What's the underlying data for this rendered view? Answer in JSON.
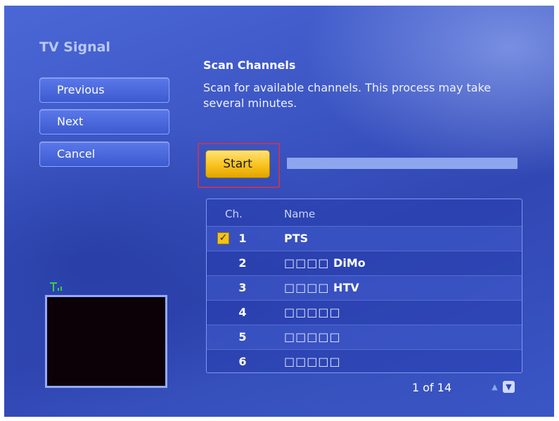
{
  "sidebar": {
    "title": "TV Signal",
    "buttons": [
      {
        "label": "Previous"
      },
      {
        "label": "Next"
      },
      {
        "label": "Cancel"
      }
    ]
  },
  "main": {
    "heading": "Scan Channels",
    "description": "Scan for available channels. This process may take several minutes.",
    "start_label": "Start",
    "progress": 0
  },
  "channel_list": {
    "headers": {
      "ch": "Ch.",
      "name": "Name"
    },
    "rows": [
      {
        "ch": "1",
        "prefix": "",
        "name": "PTS",
        "checked": true
      },
      {
        "ch": "2",
        "prefix": "□□□□",
        "name": "DiMo",
        "checked": false
      },
      {
        "ch": "3",
        "prefix": "□□□□",
        "name": "HTV",
        "checked": false
      },
      {
        "ch": "4",
        "prefix": "□□□□□",
        "name": "",
        "checked": false
      },
      {
        "ch": "5",
        "prefix": "□□□□□",
        "name": "",
        "checked": false
      },
      {
        "ch": "6",
        "prefix": "□□□□□",
        "name": "",
        "checked": false
      }
    ],
    "pager": "1 of 14",
    "up_arrow": "^",
    "down_arrow": "v"
  },
  "icons": {
    "signal": "antenna-icon",
    "check": "checkmark-icon"
  },
  "colors": {
    "accent_start": "#f9c21d",
    "background": "#3c56c4",
    "focus_frame": "#b53a5e"
  }
}
